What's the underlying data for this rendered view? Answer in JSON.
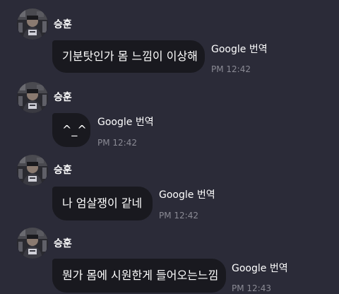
{
  "chat": {
    "translate_label": "Google 번역",
    "messages": [
      {
        "sender": "승훈",
        "text": "기분탓인가 몸 느낌이 이상해",
        "time": "PM 12:42"
      },
      {
        "sender": "승훈",
        "text": "^_^",
        "time": "PM 12:42"
      },
      {
        "sender": "승훈",
        "text": "나 엄살쟁이 같네",
        "time": "PM 12:42"
      },
      {
        "sender": "승훈",
        "text": "뭔가 몸에 시원한게 들어오는느낌",
        "time": "PM 12:43"
      }
    ]
  },
  "colors": {
    "background": "#2b2b38",
    "bubble": "#19191f",
    "text": "#ffffff",
    "timestamp": "#8a8a94"
  },
  "icons": {
    "avatar": "profile-photo-icon"
  }
}
